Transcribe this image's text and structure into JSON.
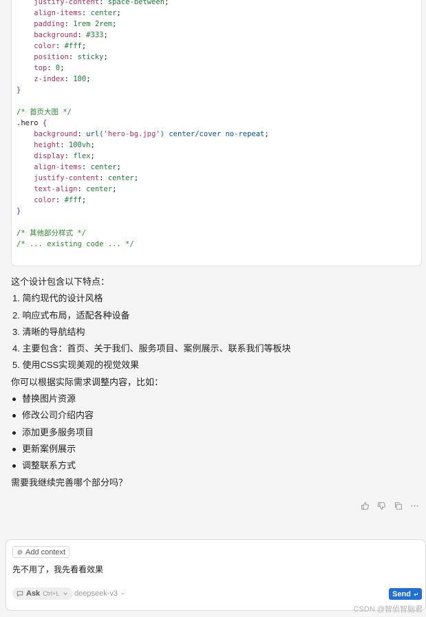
{
  "code": {
    "lines": [
      [
        {
          "t": "    ",
          "c": "pun"
        },
        {
          "t": "justify-content",
          "c": "prop"
        },
        {
          "t": ": ",
          "c": "pun"
        },
        {
          "t": "space-between",
          "c": "val"
        },
        {
          "t": ";",
          "c": "pun"
        }
      ],
      [
        {
          "t": "    ",
          "c": "pun"
        },
        {
          "t": "align-items",
          "c": "prop"
        },
        {
          "t": ": ",
          "c": "pun"
        },
        {
          "t": "center",
          "c": "val"
        },
        {
          "t": ";",
          "c": "pun"
        }
      ],
      [
        {
          "t": "    ",
          "c": "pun"
        },
        {
          "t": "padding",
          "c": "prop"
        },
        {
          "t": ": ",
          "c": "pun"
        },
        {
          "t": "1rem 2rem",
          "c": "val"
        },
        {
          "t": ";",
          "c": "pun"
        }
      ],
      [
        {
          "t": "    ",
          "c": "pun"
        },
        {
          "t": "background",
          "c": "prop"
        },
        {
          "t": ": ",
          "c": "pun"
        },
        {
          "t": "#333",
          "c": "val"
        },
        {
          "t": ";",
          "c": "pun"
        }
      ],
      [
        {
          "t": "    ",
          "c": "pun"
        },
        {
          "t": "color",
          "c": "prop"
        },
        {
          "t": ": ",
          "c": "pun"
        },
        {
          "t": "#fff",
          "c": "val"
        },
        {
          "t": ";",
          "c": "pun"
        }
      ],
      [
        {
          "t": "    ",
          "c": "pun"
        },
        {
          "t": "position",
          "c": "prop"
        },
        {
          "t": ": ",
          "c": "pun"
        },
        {
          "t": "sticky",
          "c": "val"
        },
        {
          "t": ";",
          "c": "pun"
        }
      ],
      [
        {
          "t": "    ",
          "c": "pun"
        },
        {
          "t": "top",
          "c": "prop"
        },
        {
          "t": ": ",
          "c": "pun"
        },
        {
          "t": "0",
          "c": "val"
        },
        {
          "t": ";",
          "c": "pun"
        }
      ],
      [
        {
          "t": "    ",
          "c": "pun"
        },
        {
          "t": "z-index",
          "c": "prop"
        },
        {
          "t": ": ",
          "c": "pun"
        },
        {
          "t": "100",
          "c": "val"
        },
        {
          "t": ";",
          "c": "pun"
        }
      ],
      [
        {
          "t": "}",
          "c": "brace"
        }
      ],
      [
        {
          "t": "",
          "c": "pun"
        }
      ],
      [
        {
          "t": "/* 首页大图 */",
          "c": "com"
        }
      ],
      [
        {
          "t": ".hero",
          "c": "sel"
        },
        {
          "t": " {",
          "c": "brace"
        }
      ],
      [
        {
          "t": "    ",
          "c": "pun"
        },
        {
          "t": "background",
          "c": "prop"
        },
        {
          "t": ": ",
          "c": "pun"
        },
        {
          "t": "url(",
          "c": "kw"
        },
        {
          "t": "'hero-bg.jpg'",
          "c": "prop"
        },
        {
          "t": ")",
          "c": "kw"
        },
        {
          "t": " center/cover no-repeat",
          "c": "kw"
        },
        {
          "t": ";",
          "c": "pun"
        }
      ],
      [
        {
          "t": "    ",
          "c": "pun"
        },
        {
          "t": "height",
          "c": "prop"
        },
        {
          "t": ": ",
          "c": "pun"
        },
        {
          "t": "100vh",
          "c": "val"
        },
        {
          "t": ";",
          "c": "pun"
        }
      ],
      [
        {
          "t": "    ",
          "c": "pun"
        },
        {
          "t": "display",
          "c": "prop"
        },
        {
          "t": ": ",
          "c": "pun"
        },
        {
          "t": "flex",
          "c": "val"
        },
        {
          "t": ";",
          "c": "pun"
        }
      ],
      [
        {
          "t": "    ",
          "c": "pun"
        },
        {
          "t": "align-items",
          "c": "prop"
        },
        {
          "t": ": ",
          "c": "pun"
        },
        {
          "t": "center",
          "c": "val"
        },
        {
          "t": ";",
          "c": "pun"
        }
      ],
      [
        {
          "t": "    ",
          "c": "pun"
        },
        {
          "t": "justify-content",
          "c": "prop"
        },
        {
          "t": ": ",
          "c": "pun"
        },
        {
          "t": "center",
          "c": "val"
        },
        {
          "t": ";",
          "c": "pun"
        }
      ],
      [
        {
          "t": "    ",
          "c": "pun"
        },
        {
          "t": "text-align",
          "c": "prop"
        },
        {
          "t": ": ",
          "c": "pun"
        },
        {
          "t": "center",
          "c": "val"
        },
        {
          "t": ";",
          "c": "pun"
        }
      ],
      [
        {
          "t": "    ",
          "c": "pun"
        },
        {
          "t": "color",
          "c": "prop"
        },
        {
          "t": ": ",
          "c": "pun"
        },
        {
          "t": "#fff",
          "c": "val"
        },
        {
          "t": ";",
          "c": "pun"
        }
      ],
      [
        {
          "t": "}",
          "c": "brace"
        }
      ],
      [
        {
          "t": "",
          "c": "pun"
        }
      ],
      [
        {
          "t": "/* 其他部分样式 */",
          "c": "com"
        }
      ],
      [
        {
          "t": "/* ... existing code ... */",
          "c": "com"
        }
      ]
    ]
  },
  "answer": {
    "intro": "这个设计包含以下特点：",
    "features": [
      "1. 简约现代的设计风格",
      "2. 响应式布局，适配各种设备",
      "3. 清晰的导航结构",
      "4. 主要包含：首页、关于我们、服务项目、案例展示、联系我们等板块",
      "5. 使用CSS实现美观的视觉效果"
    ],
    "adjust_intro": "你可以根据实际需求调整内容，比如：",
    "adjustments": [
      "替换图片资源",
      "修改公司介绍内容",
      "添加更多服务项目",
      "更新案例展示",
      "调整联系方式"
    ],
    "closing": "需要我继续完善哪个部分吗？"
  },
  "actions": {
    "icons": [
      "thumbs-up-icon",
      "thumbs-down-icon",
      "copy-icon",
      "more-icon"
    ]
  },
  "composer": {
    "add_context_label": "Add context",
    "input_value": "先不用了，我先看看效果",
    "mode_label": "Ask",
    "mode_shortcut": "Ctrl+L",
    "model_label": "deepseek-v3",
    "send_label": "Send"
  },
  "watermark": "CSDN @智侦智脑君",
  "colors": {
    "send_button": "#1e6fd9",
    "property": "#b5325a",
    "value": "#1a7f37",
    "comment": "#2a8a2a"
  }
}
